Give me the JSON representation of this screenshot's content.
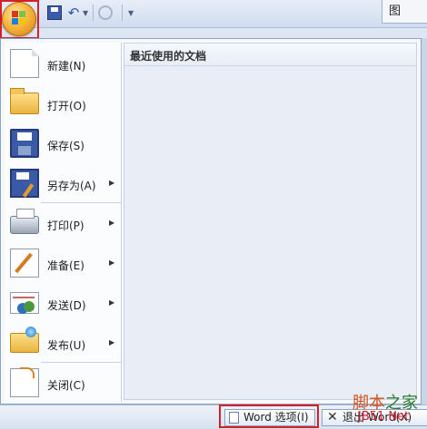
{
  "title_tab": "图",
  "recent": {
    "header": "最近使用的文档"
  },
  "menu": {
    "items": [
      {
        "label": "新建(N)",
        "icon": "new-document-icon",
        "submenu": false
      },
      {
        "label": "打开(O)",
        "icon": "open-folder-icon",
        "submenu": false
      },
      {
        "label": "保存(S)",
        "icon": "save-icon",
        "submenu": false
      },
      {
        "label": "另存为(A)",
        "icon": "save-as-icon",
        "submenu": true
      },
      {
        "label": "打印(P)",
        "icon": "printer-icon",
        "submenu": true
      },
      {
        "label": "准备(E)",
        "icon": "prepare-icon",
        "submenu": true
      },
      {
        "label": "发送(D)",
        "icon": "send-icon",
        "submenu": true
      },
      {
        "label": "发布(U)",
        "icon": "publish-icon",
        "submenu": true
      },
      {
        "label": "关闭(C)",
        "icon": "close-document-icon",
        "submenu": false
      }
    ]
  },
  "bottom": {
    "options_label": "Word 选项(I)",
    "exit_label": "退出 Word(X)"
  },
  "watermark": {
    "line1a": "脚本",
    "line1b": "之家",
    "line2": "JB51.Net"
  },
  "colors": {
    "highlight": "#d52027",
    "accent": "#3b5aa6"
  }
}
